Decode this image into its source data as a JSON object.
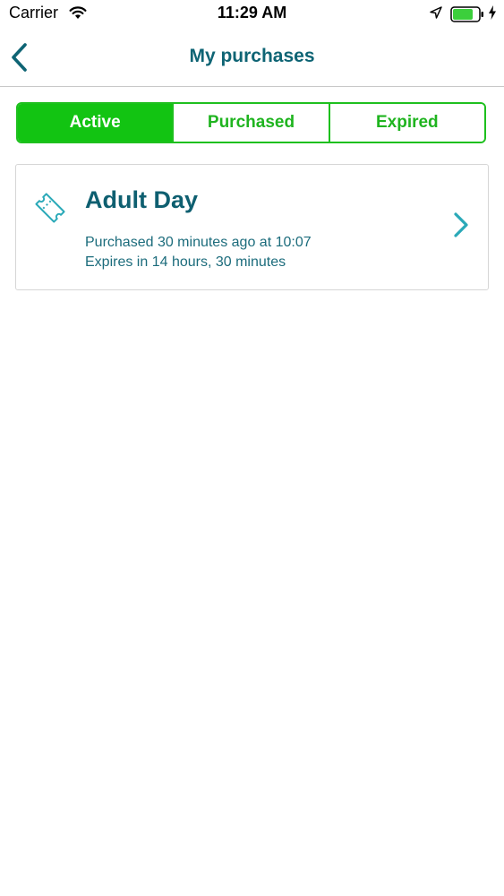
{
  "status_bar": {
    "carrier": "Carrier",
    "time": "11:29 AM",
    "icons": [
      "wifi-icon",
      "location-arrow-icon",
      "battery-icon",
      "charging-bolt-icon"
    ],
    "battery_color": "#3ccf3c"
  },
  "nav": {
    "title": "My purchases",
    "back_icon": "chevron-left-icon"
  },
  "tabs": [
    {
      "label": "Active",
      "selected": true
    },
    {
      "label": "Purchased",
      "selected": false
    },
    {
      "label": "Expired",
      "selected": false
    }
  ],
  "purchases": [
    {
      "icon": "ticket-icon",
      "title": "Adult Day",
      "purchased_text": "Purchased 30 minutes ago at 10:07",
      "expires_text": "Expires in 14 hours, 30 minutes",
      "action_icon": "chevron-right-icon"
    }
  ],
  "colors": {
    "accent_green": "#12c412",
    "title_teal": "#0e6474",
    "chevron_teal": "#2aa9b8"
  }
}
